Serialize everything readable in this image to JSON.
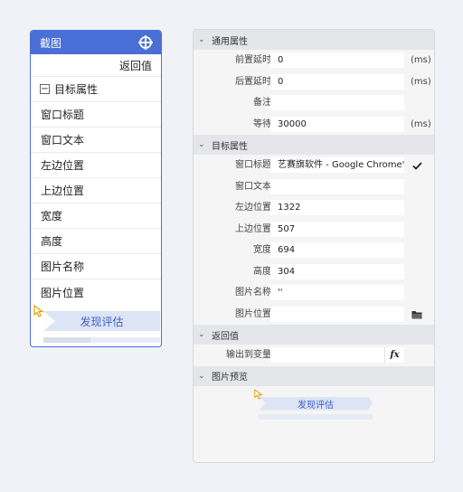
{
  "node": {
    "title": "截图",
    "return_label": "返回值",
    "group_label": "目标属性",
    "rows": [
      "窗口标题",
      "窗口文本",
      "左边位置",
      "上边位置",
      "宽度",
      "高度",
      "图片名称",
      "图片位置"
    ],
    "preview_label": "发现评估"
  },
  "panel": {
    "general": {
      "header": "通用属性",
      "pre_delay_label": "前置延时",
      "pre_delay_value": "0",
      "pre_delay_unit": "(ms)",
      "post_delay_label": "后置延时",
      "post_delay_value": "0",
      "post_delay_unit": "(ms)",
      "note_label": "备注",
      "note_value": "",
      "wait_label": "等待",
      "wait_value": "30000",
      "wait_unit": "(ms)"
    },
    "target": {
      "header": "目标属性",
      "window_title_label": "窗口标题",
      "window_title_value": "艺赛旗软件 - Google Chrome'",
      "window_text_label": "窗口文本",
      "window_text_value": "",
      "left_label": "左边位置",
      "left_value": "1322",
      "top_label": "上边位置",
      "top_value": "507",
      "width_label": "宽度",
      "width_value": "694",
      "height_label": "高度",
      "height_value": "304",
      "image_name_label": "图片名称",
      "image_name_value": "''",
      "image_path_label": "图片位置",
      "image_path_value": ""
    },
    "return": {
      "header": "返回值",
      "output_label": "输出到变量",
      "output_value": "",
      "fx_label": "fx"
    },
    "preview": {
      "header": "图片预览",
      "label": "发现评估"
    }
  },
  "colors": {
    "accent": "#4a6fd6",
    "preview_fill": "#dde4f6",
    "preview_text": "#3d5fc4"
  },
  "icons": [
    "crosshair-icon",
    "minus-box-icon",
    "cursor-icon",
    "checkmark-icon",
    "folder-icon",
    "fx-icon",
    "chevron-down-icon"
  ]
}
